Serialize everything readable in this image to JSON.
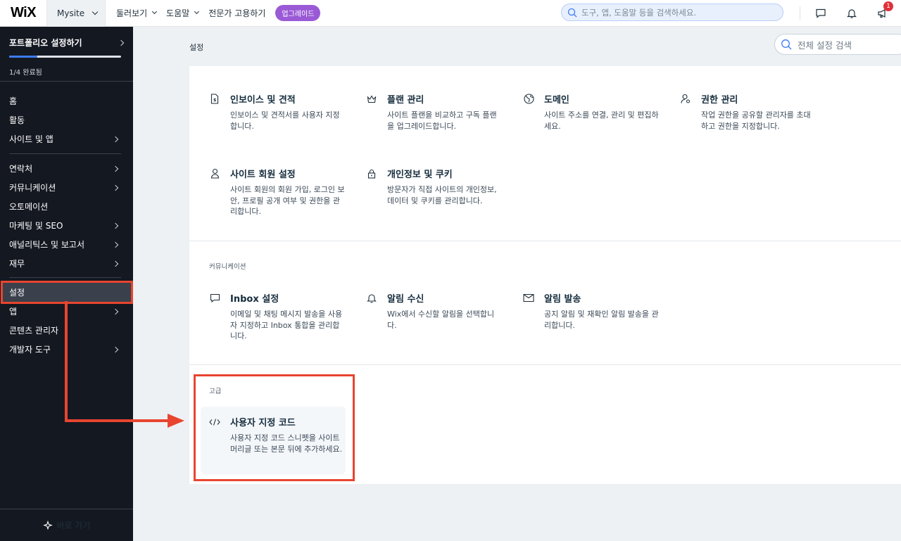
{
  "topbar": {
    "logo": "WiX",
    "site_name": "Mysite",
    "nav": [
      {
        "label": "둘러보기"
      },
      {
        "label": "도움말"
      },
      {
        "label": "전문가 고용하기"
      }
    ],
    "upgrade_label": "업그레이드",
    "search_placeholder": "도구, 앱, 도움말 등을 검색하세요.",
    "notification_count": "1"
  },
  "sidebar": {
    "setup_title": "포트폴리오 설정하기",
    "setup_progress": 0.25,
    "setup_status": "1/4 완료됨",
    "items": [
      {
        "label": "홈"
      },
      {
        "label": "활동"
      },
      {
        "label": "사이트 및 앱"
      },
      {
        "label": "연락처"
      },
      {
        "label": "커뮤니케이션"
      },
      {
        "label": "오토메이션"
      },
      {
        "label": "마케팅 및 SEO"
      },
      {
        "label": "애널리틱스 및 보고서"
      },
      {
        "label": "재무"
      },
      {
        "label": "설정"
      },
      {
        "label": "앱"
      },
      {
        "label": "콘텐츠 관리자"
      },
      {
        "label": "개발자 도구"
      }
    ],
    "back_label": "바로 가기"
  },
  "main": {
    "title": "설정",
    "search_placeholder": "전체 설정 검색",
    "cards": [
      {
        "title": "인보이스 및 견적",
        "desc": "인보이스 및 견적서를 사용자 지정합니다.",
        "icon": "invoice-icon"
      },
      {
        "title": "플랜 관리",
        "desc": "사이트 플랜을 비교하고 구독 플랜을 업그레이드합니다.",
        "icon": "crown-icon"
      },
      {
        "title": "도메인",
        "desc": "사이트 주소를 연결, 관리 및 편집하세요.",
        "icon": "globe-icon"
      },
      {
        "title": "권한 관리",
        "desc": "작업 권한을 공유할 관리자를 초대하고 권한을 지정합니다.",
        "icon": "user-key-icon"
      },
      {
        "title": "사이트 회원 설정",
        "desc": "사이트 회원의 회원 가입, 로그인 보안, 프로필 공개 여부 및 권한을 관리합니다.",
        "icon": "member-icon"
      },
      {
        "title": "개인정보 및 쿠키",
        "desc": "방문자가 직접 사이트의 개인정보, 데이터 및 쿠키를 관리합니다.",
        "icon": "lock-icon"
      }
    ],
    "communication_label": "커뮤니케이션",
    "comm_cards": [
      {
        "title": "Inbox 설정",
        "desc": "이메일 및 채팅 메시지 발송을 사용자 지정하고 Inbox 통합을 관리합니다.",
        "icon": "chat-icon"
      },
      {
        "title": "알림 수신",
        "desc": "Wix에서 수신할 알림을 선택합니다.",
        "icon": "bell-icon"
      },
      {
        "title": "알림 발송",
        "desc": "공지 알림 및 재확인 알림 발송을 관리합니다.",
        "icon": "mail-send-icon"
      }
    ],
    "advanced_label": "고급",
    "adv_card": {
      "title": "사용자 지정 코드",
      "desc": "사용자 지정 코드 스니펫을 사이트 머리글 또는 본문 뒤에 추가하세요.",
      "icon": "code-icon"
    }
  },
  "colors": {
    "highlight": "#e8452f",
    "sidebar_bg": "#141821",
    "upgrade": "#9a5ad6",
    "progress": "#3b7cf7"
  }
}
